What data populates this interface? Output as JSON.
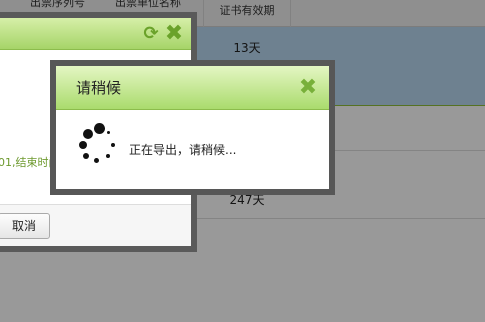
{
  "background": {
    "columns": [
      "出票序列号",
      "出票单位名称",
      "证书有效期"
    ],
    "rows": [
      {
        "validity": "13天"
      },
      {
        "validity": ""
      },
      {
        "validity": "247天"
      }
    ]
  },
  "underlying_dialog": {
    "message_fragment": "01,结束时间",
    "cancel_label": "取消",
    "refresh_icon": "refresh-icon",
    "close_icon": "close-icon"
  },
  "wait_dialog": {
    "title": "请稍候",
    "message": "正在导出，请稍候...",
    "close_icon": "close-icon",
    "spinner_icon": "loading-spinner-icon"
  },
  "colors": {
    "header_green_light": "#e4f6c3",
    "header_green_dark": "#aadb6d",
    "close_green": "#78b03a",
    "selected_row": "#b7d7f0"
  }
}
